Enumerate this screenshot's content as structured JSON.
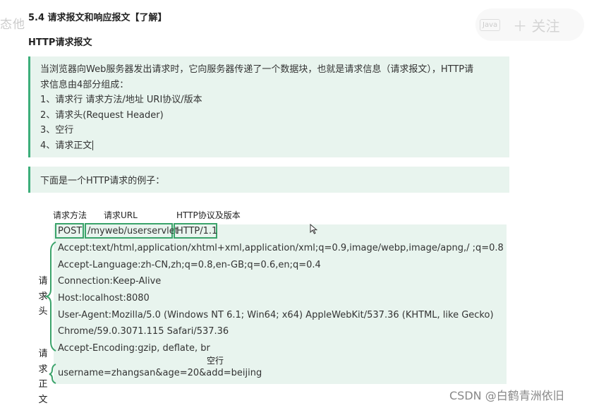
{
  "watermark": {
    "left_text": "态他",
    "tag": "Java",
    "follow": "＋ 关注"
  },
  "heading": {
    "section": "5.4 请求报文和响应报文【了解】",
    "subsection": "HTTP请求报文"
  },
  "note_intro": {
    "lines": [
      "当浏览器向Web服务器发出请求时，它向服务器传递了一个数据块，也就是请求信息（请求报文），HTTP请",
      "求信息由4部分组成：",
      "1、请求行 请求方法/地址 URI协议/版本",
      "2、请求头(Request Header)",
      "3、空行",
      "4、请求正文"
    ]
  },
  "note_example": "下面是一个HTTP请求的例子：",
  "diagram": {
    "labels": {
      "method": "请求方法",
      "url": "请求URL",
      "protocol": "HTTP协议及版本"
    },
    "request_line": {
      "method": "POST",
      "url": "/myweb/userservlet",
      "protocol": "HTTP/1.1"
    },
    "headers": [
      "Accept:text/html,application/xhtml+xml,application/xml;q=0.9,image/webp,image/apng,/ ;q=0.8",
      "Accept-Language:zh-CN,zh;q=0.8,en-GB;q=0.6,en;q=0.4",
      "Connection:Keep-Alive",
      "Host:localhost:8080",
      "User-Agent:Mozilla/5.0 (Windows NT 6.1; Win64; x64) AppleWebKit/537.36 (KHTML, like Gecko)",
      "Chrome/59.0.3071.115 Safari/537.36",
      "Accept-Encoding:gzip, deflate, br"
    ],
    "empty_line_label": "空行",
    "body": "username=zhangsan&age=20&add=beijing",
    "side_header_chars": [
      "请",
      "求",
      "头"
    ],
    "side_body_chars": [
      "请",
      "求",
      "正",
      "文"
    ]
  },
  "csdn_watermark": "CSDN @白鹤青洲依旧",
  "colors": {
    "note_bg": "#e8f4ee",
    "accent": "#3dae7a",
    "bracket": "#3aa36a"
  }
}
